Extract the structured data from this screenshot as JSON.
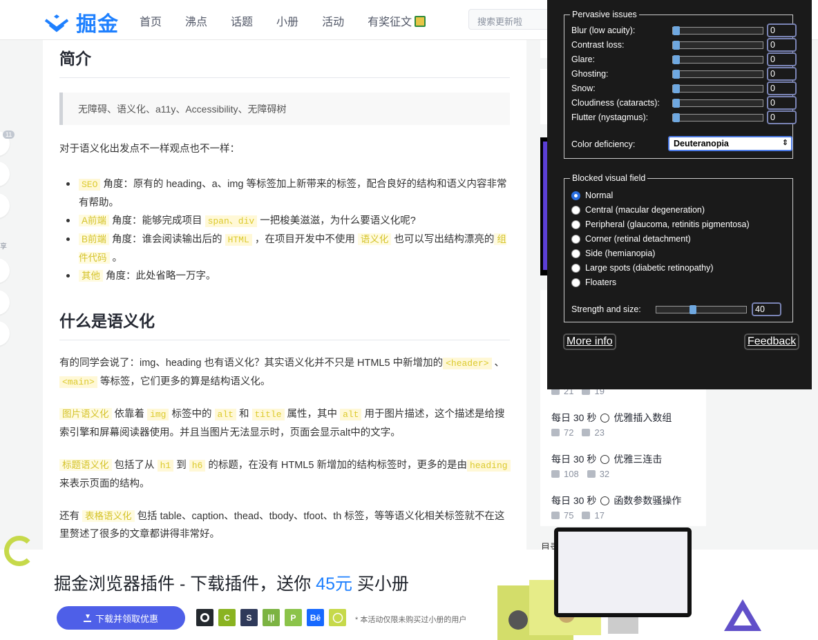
{
  "header": {
    "logo_text": "掘金",
    "nav": [
      "首页",
      "沸点",
      "话题",
      "小册",
      "活动",
      "有奖征文"
    ],
    "search_placeholder": "搜索更新啦"
  },
  "sidebar": {
    "badge": "11",
    "share": "享"
  },
  "article": {
    "h_intro": "简介",
    "quote": "无障碍、语义化、a11y、Accessibility、无障碍树",
    "p_viewpoints": "对于语义化出发点不一样观点也不一样：",
    "list": [
      {
        "tag": "SEO",
        "text": " 角度：原有的 heading、a、img 等标签加上新带来的标签，配合良好的结构和语义内容非常有帮助。"
      },
      {
        "tag": "A前端",
        "pre": " 角度：能够完成项目 ",
        "code": "span、div",
        "post": " 一把梭美滋滋，为什么要语义化呢?"
      },
      {
        "tag": "B前端",
        "pre": " 角度：谁会阅读输出后的 ",
        "code": "HTML",
        "mid": " ，在项目开发中不使用 ",
        "code2": "语义化",
        "post": " 也可以写出结构漂亮的",
        "code3": "组件代码",
        "end": " 。"
      },
      {
        "tag": "其他",
        "text": " 角度：此处省略一万字。"
      }
    ],
    "h_what": "什么是语义化",
    "p1_a": "有的同学会说了：img、heading 也有语义化？其实语义化并不只是 HTML5 中新增加的",
    "p1_code1": "<header>",
    "p1_sep": " 、 ",
    "p1_code2": "<main>",
    "p1_b": " 等标签，它们更多的算是结构语义化。",
    "p2_tag": "图片语义化",
    "p2_a": " 依靠着 ",
    "p2_img": "img",
    "p2_b": " 标签中的 ",
    "p2_alt": "alt",
    "p2_and": " 和 ",
    "p2_title": "title",
    "p2_c": " 属性，其中 ",
    "p2_alt2": "alt",
    "p2_d": " 用于图片描述，这个描述是给搜索引擎和屏幕阅读器使用。并且当图片无法显示时，页面会显示alt中的文字。",
    "p3_tag": "标题语义化",
    "p3_a": " 包括了从 ",
    "p3_h1": "h1",
    "p3_to": " 到 ",
    "p3_h6": "h6",
    "p3_b": " 的标题，在没有 HTML5 新增加的结构标签时，更多的是由",
    "p3_heading": "heading",
    "p3_c": " 来表示页面的结构。",
    "p4_a": "还有 ",
    "p4_tag": "表格语义化",
    "p4_b": " 包括 table、caption、thead、tbody、tfoot、th 标签，等等语义化相关标签就不在这里赘述了很多的文章都讲得非常好。"
  },
  "right": {
    "partial_meta": {
      "likes": "21",
      "comments": "19"
    },
    "items": [
      {
        "prefix": "每日 30 秒",
        "title": "优雅插入数组",
        "likes": "72",
        "comments": "23"
      },
      {
        "prefix": "每日 30 秒",
        "title": "优雅三连击",
        "likes": "108",
        "comments": "32"
      },
      {
        "prefix": "每日 30 秒",
        "title": "函数参数骚操作",
        "likes": "75",
        "comments": "17"
      }
    ],
    "toc_label": "目录"
  },
  "banner": {
    "title_a": "掘金浏览器插件 - 下载插件，送你 ",
    "title_accent": "45元",
    "title_b": " 买小册",
    "button": "下载并领取优惠",
    "note": "* 本活动仅限未购买过小册的用户",
    "ext_icons": [
      {
        "name": "github-icon",
        "label": "",
        "color": "#24292e"
      },
      {
        "name": "codepen-icon",
        "label": "C",
        "color": "#8ab321"
      },
      {
        "name": "stack-icon",
        "label": "S",
        "color": "#2f3a5a"
      },
      {
        "name": "chart-icon",
        "label": "l|l",
        "color": "#7cb342"
      },
      {
        "name": "producthunt-icon",
        "label": "P",
        "color": "#8bc34a"
      },
      {
        "name": "behance-icon",
        "label": "Bē",
        "color": "#1769ff"
      },
      {
        "name": "dribbble-icon",
        "label": "",
        "color": "#c6d94a"
      }
    ]
  },
  "panel": {
    "pervasive_legend": "Pervasive issues",
    "sliders": [
      {
        "label": "Blur (low acuity):",
        "value": "0"
      },
      {
        "label": "Contrast loss:",
        "value": "0"
      },
      {
        "label": "Glare:",
        "value": "0"
      },
      {
        "label": "Ghosting:",
        "value": "0"
      },
      {
        "label": "Snow:",
        "value": "0"
      },
      {
        "label": "Cloudiness (cataracts):",
        "value": "0"
      },
      {
        "label": "Flutter (nystagmus):",
        "value": "0"
      }
    ],
    "color_label": "Color deficiency:",
    "color_value": "Deuteranopia",
    "blocked_legend": "Blocked visual field",
    "radios": [
      {
        "label": "Normal",
        "checked": true
      },
      {
        "label": "Central (macular degeneration)",
        "checked": false
      },
      {
        "label": "Peripheral (glaucoma, retinitis pigmentosa)",
        "checked": false
      },
      {
        "label": "Corner (retinal detachment)",
        "checked": false
      },
      {
        "label": "Side (hemianopia)",
        "checked": false
      },
      {
        "label": "Large spots (diabetic retinopathy)",
        "checked": false
      },
      {
        "label": "Floaters",
        "checked": false
      }
    ],
    "strength_label": "Strength and size:",
    "strength_value": "40",
    "strength_fraction": 0.4,
    "more_info": "More info",
    "feedback": "Feedback"
  }
}
